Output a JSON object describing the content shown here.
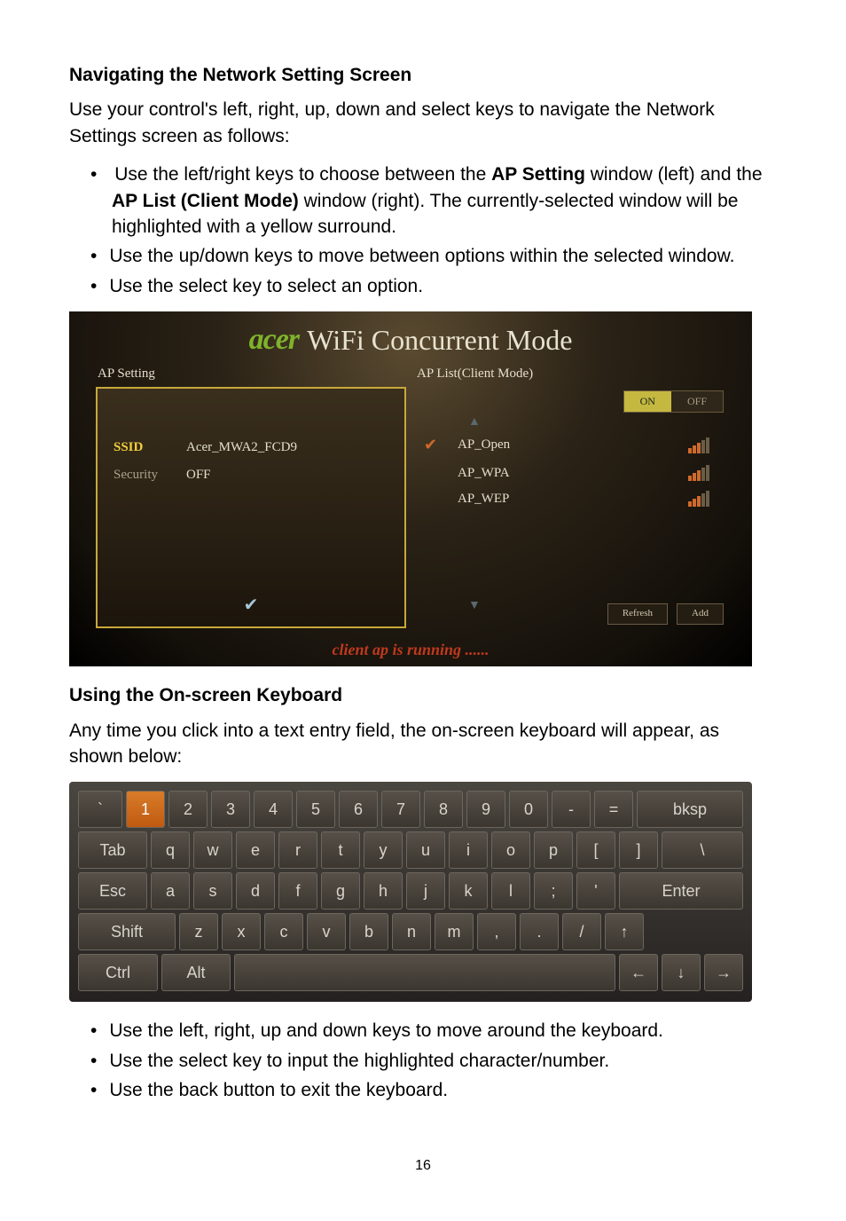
{
  "heading1": "Navigating the Network Setting Screen",
  "para1": "Use your control's left, right, up, down and select keys to navigate the Network Settings screen as follows:",
  "bullets1_pre": "Use the left/right keys to choose between the ",
  "bullets1_bold1": "AP Setting",
  "bullets1_mid1": " window (left) and the ",
  "bullets1_bold2": "AP List (Client Mode)",
  "bullets1_post": " window (right). The currently-selected window will be highlighted with a yellow surround.",
  "bullets1_item2": "Use the up/down keys to move between options within the selected window.",
  "bullets1_item3": "Use the select key to select an option.",
  "wifi": {
    "logo": "acer",
    "title": "WiFi Concurrent Mode",
    "ap_setting_hdr": "AP Setting",
    "ap_list_hdr": "AP List(Client Mode)",
    "ssid_label": "SSID",
    "ssid_value": "Acer_MWA2_FCD9",
    "security_label": "Security",
    "security_value": "OFF",
    "on": "ON",
    "off": "OFF",
    "ap1": "AP_Open",
    "ap2": "AP_WPA",
    "ap3": "AP_WEP",
    "refresh": "Refresh",
    "add": "Add",
    "status": "client ap is running ......"
  },
  "heading2": "Using the On-screen Keyboard",
  "para2": "Any time you click into a text entry field, the on-screen keyboard will appear, as shown below:",
  "kbd": {
    "r1": [
      "`",
      "1",
      "2",
      "3",
      "4",
      "5",
      "6",
      "7",
      "8",
      "9",
      "0",
      "-",
      "=",
      "bksp"
    ],
    "r2": [
      "Tab",
      "q",
      "w",
      "e",
      "r",
      "t",
      "y",
      "u",
      "i",
      "o",
      "p",
      "[",
      "]",
      "\\"
    ],
    "r3": [
      "Esc",
      "a",
      "s",
      "d",
      "f",
      "g",
      "h",
      "j",
      "k",
      "l",
      ";",
      "'",
      "Enter"
    ],
    "r4": [
      "Shift",
      "z",
      "x",
      "c",
      "v",
      "b",
      "n",
      "m",
      ",",
      ".",
      "/",
      "↑"
    ],
    "r5": [
      "Ctrl",
      "Alt",
      " ",
      "←",
      "↓",
      "→"
    ]
  },
  "bullets2_item1": "Use the left, right, up and down keys to move around the keyboard.",
  "bullets2_item2": "Use the select key to input the highlighted character/number.",
  "bullets2_item3": "Use the back button to exit the keyboard.",
  "page_number": "16"
}
